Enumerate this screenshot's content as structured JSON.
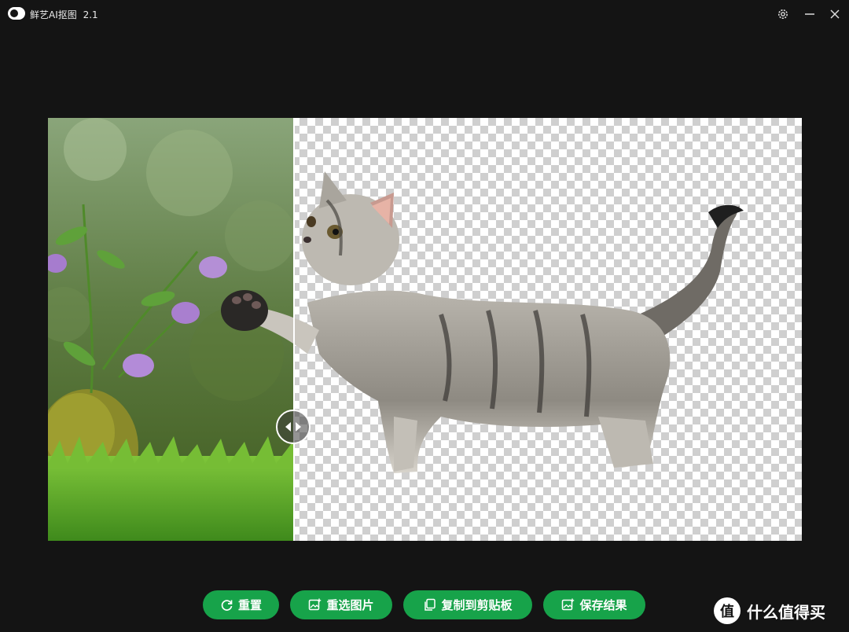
{
  "app": {
    "name": "鲜艺AI抠图",
    "version": "2.1"
  },
  "window_controls": {
    "settings_icon": "gear-icon",
    "minimize_icon": "minimize-icon",
    "close_icon": "close-icon"
  },
  "preview": {
    "split_fraction": 0.327,
    "left_image": "original-photo-cat-flowers-grass",
    "right_image": "cutout-cat-transparent-background",
    "handle_icon": "compare-arrows-icon"
  },
  "actions": {
    "reset": {
      "label": "重置",
      "icon": "refresh-icon"
    },
    "reselect": {
      "label": "重选图片",
      "icon": "image-add-icon"
    },
    "copy": {
      "label": "复制到剪贴板",
      "icon": "copy-icon"
    },
    "save": {
      "label": "保存结果",
      "icon": "image-save-icon"
    }
  },
  "watermark": {
    "logo": "值",
    "text": "什么值得买"
  },
  "colors": {
    "background": "#141414",
    "accent_green": "#17a34a"
  }
}
